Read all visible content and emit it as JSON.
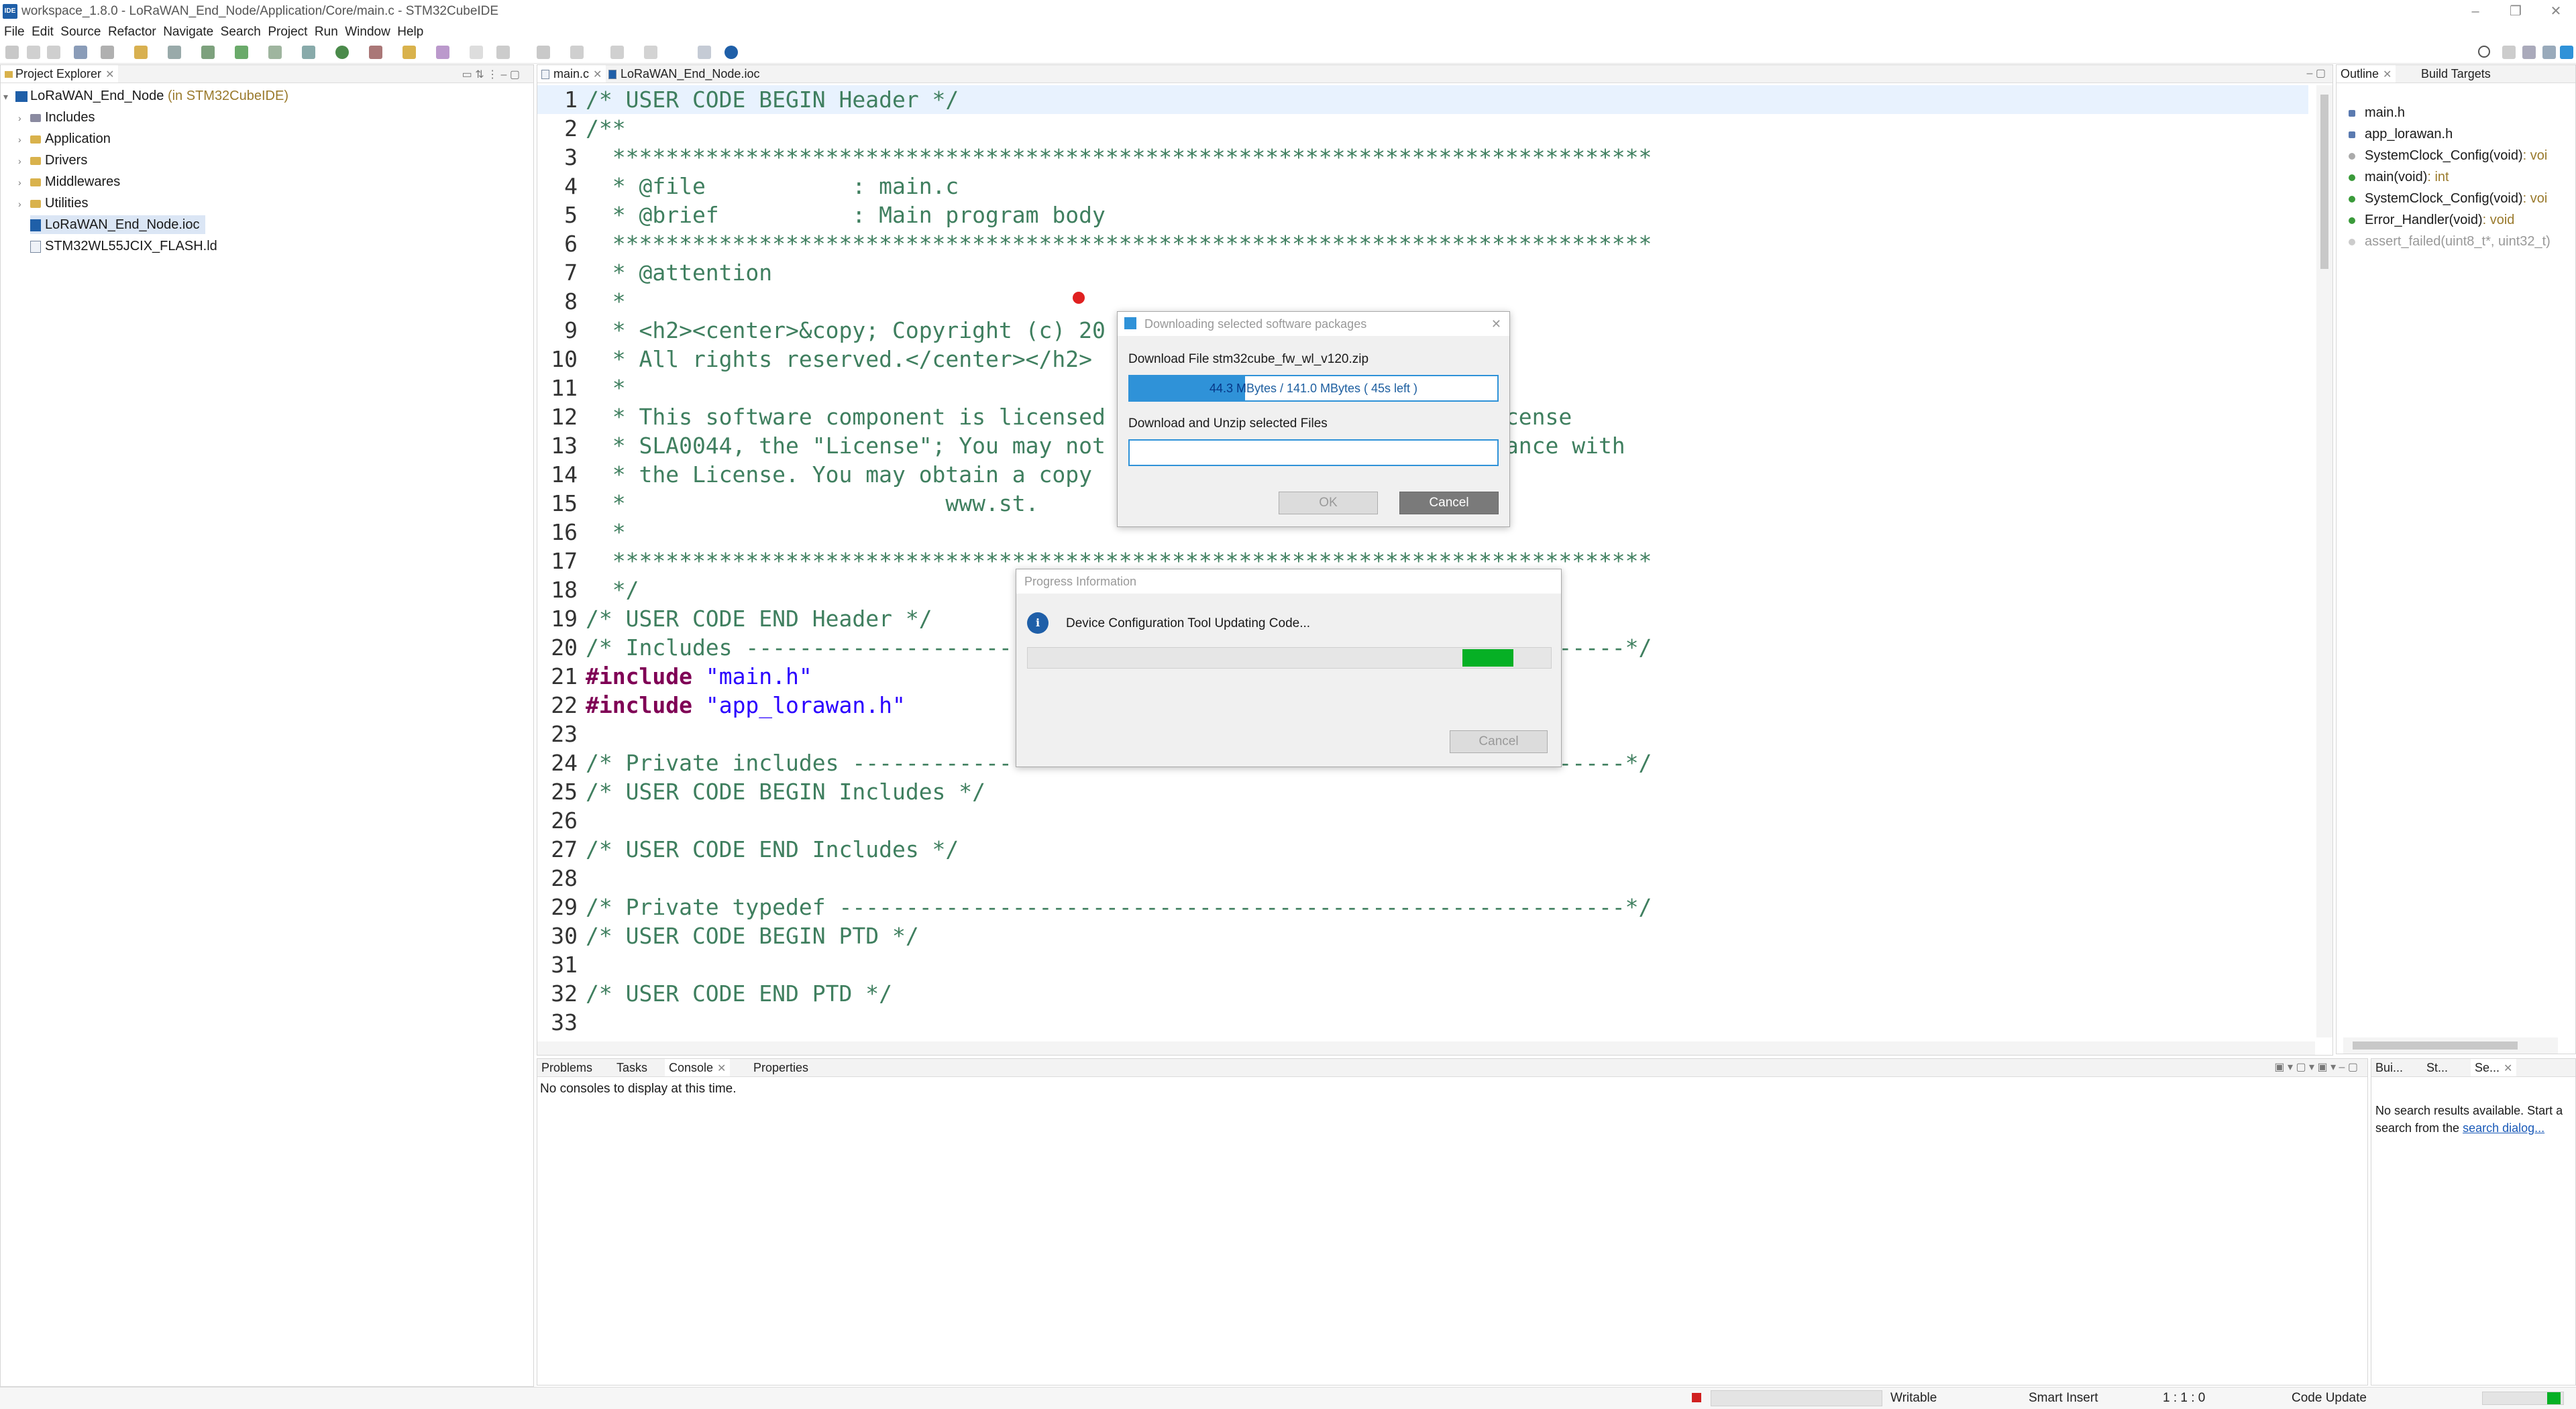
{
  "window": {
    "title": "workspace_1.8.0 - LoRaWAN_End_Node/Application/Core/main.c - STM32CubeIDE",
    "icon": "IDE"
  },
  "menu": [
    "File",
    "Edit",
    "Source",
    "Refactor",
    "Navigate",
    "Search",
    "Project",
    "Run",
    "Window",
    "Help"
  ],
  "project_explorer": {
    "tab_label": "Project Explorer",
    "root_label": "LoRaWAN_End_Node",
    "root_suffix": "(in STM32CubeIDE)",
    "items": [
      {
        "label": "Includes"
      },
      {
        "label": "Application"
      },
      {
        "label": "Drivers"
      },
      {
        "label": "Middlewares"
      },
      {
        "label": "Utilities"
      },
      {
        "label": "LoRaWAN_End_Node.ioc"
      },
      {
        "label": "STM32WL55JCIX_FLASH.ld"
      }
    ]
  },
  "editor": {
    "tabs": [
      {
        "label": "main.c"
      },
      {
        "label": "LoRaWAN_End_Node.ioc"
      }
    ],
    "lines": [
      {
        "n": "1",
        "text": "/* USER CODE BEGIN Header */"
      },
      {
        "n": "2",
        "text": "/**"
      },
      {
        "n": "3",
        "text": "  ******************************************************************************"
      },
      {
        "n": "4",
        "text": "  * @file           : main.c"
      },
      {
        "n": "5",
        "text": "  * @brief          : Main program body"
      },
      {
        "n": "6",
        "text": "  ******************************************************************************"
      },
      {
        "n": "7",
        "text": "  * @attention"
      },
      {
        "n": "8",
        "text": "  *"
      },
      {
        "n": "9",
        "text": "  * <h2><center>&copy; Copyright (c) 20"
      },
      {
        "n": "10",
        "text": "  * All rights reserved.</center></h2>"
      },
      {
        "n": "11",
        "text": "  *"
      },
      {
        "n": "12",
        "text": "  * This software component is licensed                            license"
      },
      {
        "n": "13",
        "text": "  * SLA0044, the \"License\"; You may not                            liance with"
      },
      {
        "n": "14",
        "text": "  * the License. You may obtain a copy"
      },
      {
        "n": "15",
        "text": "  *                        www.st."
      },
      {
        "n": "16",
        "text": "  *"
      },
      {
        "n": "17",
        "text": "  ******************************************************************************"
      },
      {
        "n": "18",
        "text": "  */"
      },
      {
        "n": "19",
        "text": "/* USER CODE END Header */"
      },
      {
        "n": "20",
        "text": "/* Includes ------------------------------------------------------------------*/"
      },
      {
        "n": "21",
        "pre": "#include",
        "str": "\"main.h\""
      },
      {
        "n": "22",
        "pre": "#include",
        "str": "\"app_lorawan.h\""
      },
      {
        "n": "23",
        "text": ""
      },
      {
        "n": "24",
        "text": "/* Private includes ----------------------------------------------------------*/"
      },
      {
        "n": "25",
        "text": "/* USER CODE BEGIN Includes */"
      },
      {
        "n": "26",
        "text": ""
      },
      {
        "n": "27",
        "text": "/* USER CODE END Includes */"
      },
      {
        "n": "28",
        "text": ""
      },
      {
        "n": "29",
        "text": "/* Private typedef -----------------------------------------------------------*/"
      },
      {
        "n": "30",
        "text": "/* USER CODE BEGIN PTD */"
      },
      {
        "n": "31",
        "text": ""
      },
      {
        "n": "32",
        "text": "/* USER CODE END PTD */"
      },
      {
        "n": "33",
        "text": ""
      }
    ]
  },
  "outline": {
    "tabs": [
      {
        "label": "Outline"
      },
      {
        "label": "Build Targets"
      }
    ],
    "items": [
      {
        "name": "main.h",
        "type": ""
      },
      {
        "name": "app_lorawan.h",
        "type": ""
      },
      {
        "name": "SystemClock_Config(void)",
        "type": ": voi"
      },
      {
        "name": "main(void)",
        "type": ": int"
      },
      {
        "name": "SystemClock_Config(void)",
        "type": ": voi"
      },
      {
        "name": "Error_Handler(void)",
        "type": ": void"
      },
      {
        "name": "assert_failed(uint8_t*, uint32_t)",
        "type": ""
      }
    ]
  },
  "bottom": {
    "tabs": [
      {
        "label": "Problems"
      },
      {
        "label": "Tasks"
      },
      {
        "label": "Console"
      },
      {
        "label": "Properties"
      }
    ],
    "message": "No consoles to display at this time."
  },
  "search": {
    "tabs": [
      {
        "label": "Bui..."
      },
      {
        "label": "St..."
      },
      {
        "label": "Se..."
      }
    ],
    "message": "No search results available. Start a search from the",
    "link": "search dialog..."
  },
  "download_dialog": {
    "title": "Downloading selected software packages",
    "file_label": "Download File stm32cube_fw_wl_v120.zip",
    "progress_text": "44.3 MBytes / 141.0 MBytes  ( 45s left )",
    "progress_fraction": 0.314,
    "unzip_label": "Download and Unzip selected Files",
    "ok": "OK",
    "cancel": "Cancel"
  },
  "progress_dialog": {
    "title": "Progress Information",
    "message": "Device Configuration Tool Updating Code...",
    "cancel": "Cancel"
  },
  "status": {
    "writable": "Writable",
    "insert_mode": "Smart Insert",
    "position": "1 : 1 : 0",
    "task": "Code Update"
  },
  "colors": {
    "progress_blue": "#2f92d8",
    "progress_green": "#06b025",
    "comment": "#3f7f5f",
    "keyword": "#7f0055",
    "string": "#2a00ff"
  }
}
